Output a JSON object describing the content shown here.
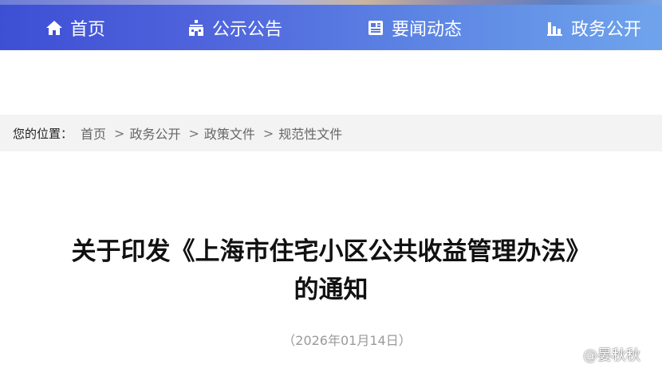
{
  "nav": {
    "items": [
      {
        "label": "首页",
        "icon": "home-icon"
      },
      {
        "label": "公示公告",
        "icon": "building-icon"
      },
      {
        "label": "要闻动态",
        "icon": "newspaper-icon"
      },
      {
        "label": "政务公开",
        "icon": "bar-chart-icon"
      }
    ]
  },
  "breadcrumb": {
    "label": "您的位置：",
    "items": [
      "首页",
      "政务公开",
      "政策文件",
      "规范性文件"
    ],
    "separator": ">"
  },
  "article": {
    "title": "关于印发《上海市住宅小区公共收益管理办法》的通知",
    "date": "（2026年01月14日）"
  },
  "watermark": {
    "text": "@晏秋秋",
    "icon": "weibo-icon"
  },
  "colors": {
    "nav_gradient_start": "#3d4fd4",
    "nav_gradient_end": "#6fa4ec",
    "breadcrumb_bg": "#f3f3f3",
    "title_text": "#111111",
    "date_text": "#9a9a9a"
  }
}
